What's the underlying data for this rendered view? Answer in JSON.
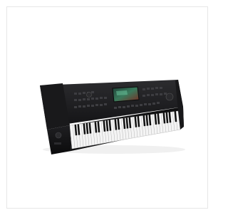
{
  "product": {
    "name": "arranger-keyboard",
    "body_color": "#1b1b1d",
    "key_white": "#f4f4f4",
    "key_black": "#111111",
    "screen_color": "#3a7a5c",
    "screen_accent": "#c0392b"
  }
}
